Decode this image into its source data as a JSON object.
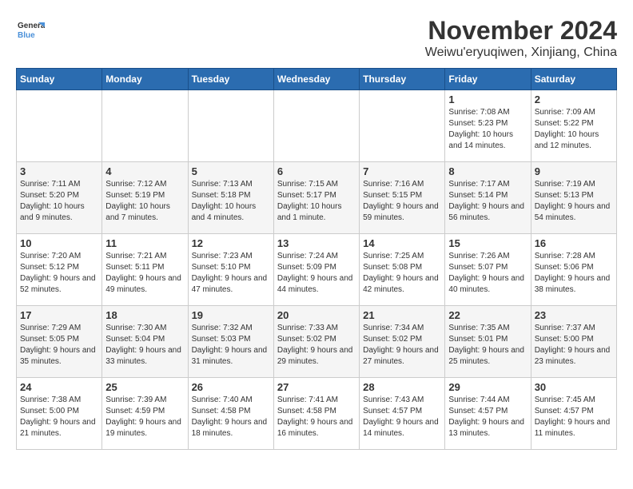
{
  "logo": {
    "text_general": "General",
    "text_blue": "Blue"
  },
  "title": {
    "month_year": "November 2024",
    "location": "Weiwu'eryuqiwen, Xinjiang, China"
  },
  "headers": [
    "Sunday",
    "Monday",
    "Tuesday",
    "Wednesday",
    "Thursday",
    "Friday",
    "Saturday"
  ],
  "weeks": [
    [
      {
        "day": "",
        "content": ""
      },
      {
        "day": "",
        "content": ""
      },
      {
        "day": "",
        "content": ""
      },
      {
        "day": "",
        "content": ""
      },
      {
        "day": "",
        "content": ""
      },
      {
        "day": "1",
        "content": "Sunrise: 7:08 AM\nSunset: 5:23 PM\nDaylight: 10 hours and 14 minutes."
      },
      {
        "day": "2",
        "content": "Sunrise: 7:09 AM\nSunset: 5:22 PM\nDaylight: 10 hours and 12 minutes."
      }
    ],
    [
      {
        "day": "3",
        "content": "Sunrise: 7:11 AM\nSunset: 5:20 PM\nDaylight: 10 hours and 9 minutes."
      },
      {
        "day": "4",
        "content": "Sunrise: 7:12 AM\nSunset: 5:19 PM\nDaylight: 10 hours and 7 minutes."
      },
      {
        "day": "5",
        "content": "Sunrise: 7:13 AM\nSunset: 5:18 PM\nDaylight: 10 hours and 4 minutes."
      },
      {
        "day": "6",
        "content": "Sunrise: 7:15 AM\nSunset: 5:17 PM\nDaylight: 10 hours and 1 minute."
      },
      {
        "day": "7",
        "content": "Sunrise: 7:16 AM\nSunset: 5:15 PM\nDaylight: 9 hours and 59 minutes."
      },
      {
        "day": "8",
        "content": "Sunrise: 7:17 AM\nSunset: 5:14 PM\nDaylight: 9 hours and 56 minutes."
      },
      {
        "day": "9",
        "content": "Sunrise: 7:19 AM\nSunset: 5:13 PM\nDaylight: 9 hours and 54 minutes."
      }
    ],
    [
      {
        "day": "10",
        "content": "Sunrise: 7:20 AM\nSunset: 5:12 PM\nDaylight: 9 hours and 52 minutes."
      },
      {
        "day": "11",
        "content": "Sunrise: 7:21 AM\nSunset: 5:11 PM\nDaylight: 9 hours and 49 minutes."
      },
      {
        "day": "12",
        "content": "Sunrise: 7:23 AM\nSunset: 5:10 PM\nDaylight: 9 hours and 47 minutes."
      },
      {
        "day": "13",
        "content": "Sunrise: 7:24 AM\nSunset: 5:09 PM\nDaylight: 9 hours and 44 minutes."
      },
      {
        "day": "14",
        "content": "Sunrise: 7:25 AM\nSunset: 5:08 PM\nDaylight: 9 hours and 42 minutes."
      },
      {
        "day": "15",
        "content": "Sunrise: 7:26 AM\nSunset: 5:07 PM\nDaylight: 9 hours and 40 minutes."
      },
      {
        "day": "16",
        "content": "Sunrise: 7:28 AM\nSunset: 5:06 PM\nDaylight: 9 hours and 38 minutes."
      }
    ],
    [
      {
        "day": "17",
        "content": "Sunrise: 7:29 AM\nSunset: 5:05 PM\nDaylight: 9 hours and 35 minutes."
      },
      {
        "day": "18",
        "content": "Sunrise: 7:30 AM\nSunset: 5:04 PM\nDaylight: 9 hours and 33 minutes."
      },
      {
        "day": "19",
        "content": "Sunrise: 7:32 AM\nSunset: 5:03 PM\nDaylight: 9 hours and 31 minutes."
      },
      {
        "day": "20",
        "content": "Sunrise: 7:33 AM\nSunset: 5:02 PM\nDaylight: 9 hours and 29 minutes."
      },
      {
        "day": "21",
        "content": "Sunrise: 7:34 AM\nSunset: 5:02 PM\nDaylight: 9 hours and 27 minutes."
      },
      {
        "day": "22",
        "content": "Sunrise: 7:35 AM\nSunset: 5:01 PM\nDaylight: 9 hours and 25 minutes."
      },
      {
        "day": "23",
        "content": "Sunrise: 7:37 AM\nSunset: 5:00 PM\nDaylight: 9 hours and 23 minutes."
      }
    ],
    [
      {
        "day": "24",
        "content": "Sunrise: 7:38 AM\nSunset: 5:00 PM\nDaylight: 9 hours and 21 minutes."
      },
      {
        "day": "25",
        "content": "Sunrise: 7:39 AM\nSunset: 4:59 PM\nDaylight: 9 hours and 19 minutes."
      },
      {
        "day": "26",
        "content": "Sunrise: 7:40 AM\nSunset: 4:58 PM\nDaylight: 9 hours and 18 minutes."
      },
      {
        "day": "27",
        "content": "Sunrise: 7:41 AM\nSunset: 4:58 PM\nDaylight: 9 hours and 16 minutes."
      },
      {
        "day": "28",
        "content": "Sunrise: 7:43 AM\nSunset: 4:57 PM\nDaylight: 9 hours and 14 minutes."
      },
      {
        "day": "29",
        "content": "Sunrise: 7:44 AM\nSunset: 4:57 PM\nDaylight: 9 hours and 13 minutes."
      },
      {
        "day": "30",
        "content": "Sunrise: 7:45 AM\nSunset: 4:57 PM\nDaylight: 9 hours and 11 minutes."
      }
    ]
  ]
}
